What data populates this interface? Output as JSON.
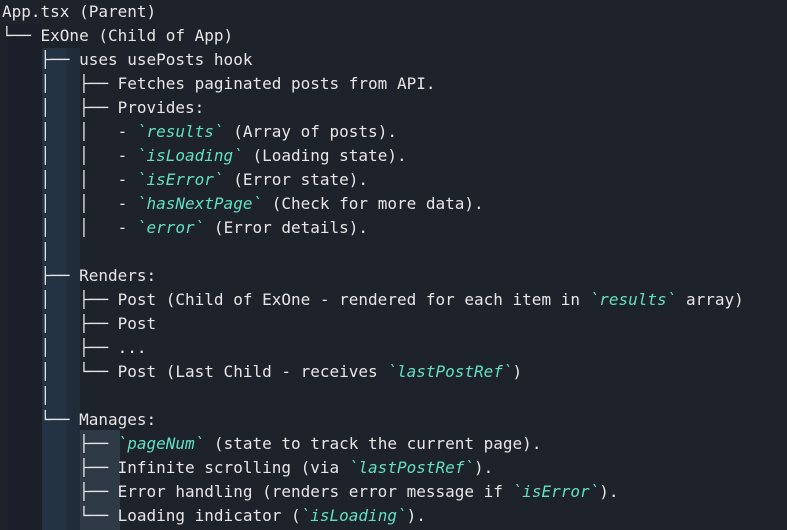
{
  "lines": [
    {
      "segs": [
        {
          "t": "App.tsx (Parent)"
        }
      ]
    },
    {
      "segs": [
        {
          "t": "└── ExOne (Child of App)"
        }
      ]
    },
    {
      "segs": [
        {
          "t": "    ├── uses usePosts hook"
        }
      ]
    },
    {
      "segs": [
        {
          "t": "    │   ├── Fetches paginated posts from API."
        }
      ]
    },
    {
      "segs": [
        {
          "t": "    │   ├── Provides:"
        }
      ]
    },
    {
      "segs": [
        {
          "t": "    │   │   - "
        },
        {
          "t": "`results`",
          "c": 1
        },
        {
          "t": " (Array of posts)."
        }
      ]
    },
    {
      "segs": [
        {
          "t": "    │   │   - "
        },
        {
          "t": "`isLoading`",
          "c": 1
        },
        {
          "t": " (Loading state)."
        }
      ]
    },
    {
      "segs": [
        {
          "t": "    │   │   - "
        },
        {
          "t": "`isError`",
          "c": 1
        },
        {
          "t": " (Error state)."
        }
      ]
    },
    {
      "segs": [
        {
          "t": "    │   │   - "
        },
        {
          "t": "`hasNextPage`",
          "c": 1
        },
        {
          "t": " (Check for more data)."
        }
      ]
    },
    {
      "segs": [
        {
          "t": "    │   │   - "
        },
        {
          "t": "`error`",
          "c": 1
        },
        {
          "t": " (Error details)."
        }
      ]
    },
    {
      "segs": [
        {
          "t": "    │"
        }
      ]
    },
    {
      "segs": [
        {
          "t": "    ├── Renders:"
        }
      ]
    },
    {
      "segs": [
        {
          "t": "    │   ├── Post (Child of ExOne - rendered for each item in "
        },
        {
          "t": "`results`",
          "c": 1
        },
        {
          "t": " array)"
        }
      ]
    },
    {
      "segs": [
        {
          "t": "    │   ├── Post"
        }
      ]
    },
    {
      "segs": [
        {
          "t": "    │   ├── ..."
        }
      ]
    },
    {
      "segs": [
        {
          "t": "    │   └── Post (Last Child - receives "
        },
        {
          "t": "`lastPostRef`",
          "c": 1
        },
        {
          "t": ")"
        }
      ]
    },
    {
      "segs": [
        {
          "t": "    │"
        }
      ]
    },
    {
      "segs": [
        {
          "t": "    └── Manages:"
        }
      ]
    },
    {
      "segs": [
        {
          "t": "        ├── "
        },
        {
          "t": "`pageNum`",
          "c": 1
        },
        {
          "t": " (state to track the current page)."
        }
      ]
    },
    {
      "segs": [
        {
          "t": "        ├── Infinite scrolling (via "
        },
        {
          "t": "`lastPostRef`",
          "c": 1
        },
        {
          "t": ")."
        }
      ]
    },
    {
      "segs": [
        {
          "t": "        ├── Error handling (renders error message if "
        },
        {
          "t": "`isError`",
          "c": 1
        },
        {
          "t": ")."
        }
      ]
    },
    {
      "segs": [
        {
          "t": "        └── Loading indicator ("
        },
        {
          "t": "`isLoading`",
          "c": 1
        },
        {
          "t": ")."
        }
      ]
    }
  ]
}
